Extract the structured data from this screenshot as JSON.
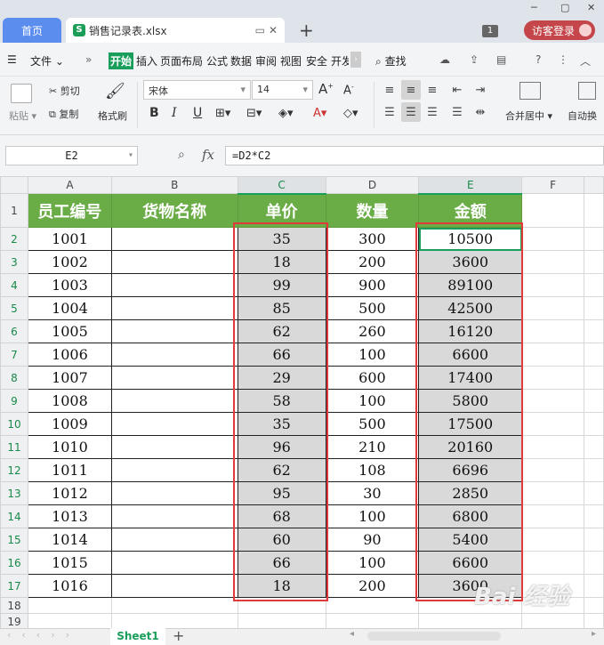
{
  "tabs": {
    "home": "首页",
    "file": "销售记录表.xlsx",
    "badge": "1",
    "login": "访客登录"
  },
  "menu": {
    "file": "文件",
    "more": "»",
    "items": [
      "开始",
      "插入",
      "页面布局",
      "公式",
      "数据",
      "审阅",
      "视图",
      "安全",
      "开发"
    ],
    "search": "查找"
  },
  "toolbar": {
    "paste": "粘贴",
    "cut": "剪切",
    "copy": "复制",
    "format_painter": "格式刷",
    "font_name": "宋体",
    "font_size": "14",
    "merge_center": "合并居中",
    "auto_wrap": "自动换"
  },
  "formula_bar": {
    "name_box": "E2",
    "fx": "fx",
    "formula": "=D2*C2"
  },
  "sheet": {
    "columns": [
      "A",
      "B",
      "C",
      "D",
      "E",
      "F"
    ],
    "headers": [
      "员工编号",
      "货物名称",
      "单价",
      "数量",
      "金额"
    ],
    "rows": [
      {
        "row": "2",
        "id": "1001",
        "name": "",
        "price": "35",
        "qty": "300",
        "amount": "10500"
      },
      {
        "row": "3",
        "id": "1002",
        "name": "",
        "price": "18",
        "qty": "200",
        "amount": "3600"
      },
      {
        "row": "4",
        "id": "1003",
        "name": "",
        "price": "99",
        "qty": "900",
        "amount": "89100"
      },
      {
        "row": "5",
        "id": "1004",
        "name": "",
        "price": "85",
        "qty": "500",
        "amount": "42500"
      },
      {
        "row": "6",
        "id": "1005",
        "name": "",
        "price": "62",
        "qty": "260",
        "amount": "16120"
      },
      {
        "row": "7",
        "id": "1006",
        "name": "",
        "price": "66",
        "qty": "100",
        "amount": "6600"
      },
      {
        "row": "8",
        "id": "1007",
        "name": "",
        "price": "29",
        "qty": "600",
        "amount": "17400"
      },
      {
        "row": "9",
        "id": "1008",
        "name": "",
        "price": "58",
        "qty": "100",
        "amount": "5800"
      },
      {
        "row": "10",
        "id": "1009",
        "name": "",
        "price": "35",
        "qty": "500",
        "amount": "17500"
      },
      {
        "row": "11",
        "id": "1010",
        "name": "",
        "price": "96",
        "qty": "210",
        "amount": "20160"
      },
      {
        "row": "12",
        "id": "1011",
        "name": "",
        "price": "62",
        "qty": "108",
        "amount": "6696"
      },
      {
        "row": "13",
        "id": "1012",
        "name": "",
        "price": "95",
        "qty": "30",
        "amount": "2850"
      },
      {
        "row": "14",
        "id": "1013",
        "name": "",
        "price": "68",
        "qty": "100",
        "amount": "6800"
      },
      {
        "row": "15",
        "id": "1014",
        "name": "",
        "price": "60",
        "qty": "90",
        "amount": "5400"
      },
      {
        "row": "16",
        "id": "1015",
        "name": "",
        "price": "66",
        "qty": "100",
        "amount": "6600"
      },
      {
        "row": "17",
        "id": "1016",
        "name": "",
        "price": "18",
        "qty": "200",
        "amount": "3600"
      }
    ],
    "empty_rows": [
      "18",
      "19"
    ]
  },
  "bottom": {
    "sheet_tab": "Sheet1",
    "add": "+"
  },
  "watermark": "Bai 经验",
  "colors": {
    "accent": "#1a9e5b",
    "header_fill": "#6aac46",
    "highlight": "#e03a3a",
    "selection_fill": "#d9d9d9"
  }
}
